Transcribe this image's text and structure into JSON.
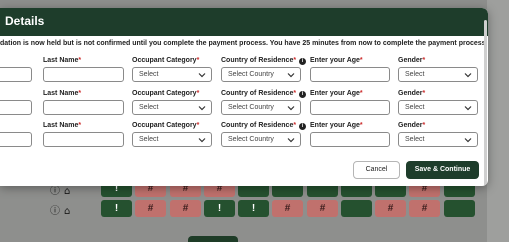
{
  "modal": {
    "title": "Details",
    "notice": "dation is now held but is not confirmed until you complete the payment process. You have 25 minutes from now to complete the payment process.",
    "required_mark": "*",
    "labels": {
      "last_name": "Last Name",
      "occupant_category": "Occupant Category",
      "country": "Country of Residence",
      "age": "Enter your Age",
      "gender": "Gender"
    },
    "rows": [
      {
        "first_name": "",
        "last_name": "",
        "occupant_category": "Select",
        "country": "Select Country",
        "age": "",
        "gender": "Select"
      },
      {
        "first_name": "",
        "last_name": "",
        "occupant_category": "Select",
        "country": "Select Country",
        "age": "",
        "gender": "Select"
      },
      {
        "first_name": "",
        "last_name": "",
        "occupant_category": "Select",
        "country": "Select Country",
        "age": "",
        "gender": "Select"
      }
    ],
    "cancel_label": "Cancel",
    "save_label": "Save & Continue"
  },
  "background": {
    "icons": [
      "info-icon",
      "home-icon"
    ],
    "rows": [
      {
        "cells": [
          "!",
          "#",
          "#",
          "#",
          "",
          "",
          "",
          "",
          "",
          "#",
          ""
        ]
      },
      {
        "cells": [
          "!",
          "#",
          "#",
          "!",
          "!",
          "#",
          "#",
          "",
          "#",
          "#",
          ""
        ]
      }
    ],
    "colors": {
      "green": "#25512f",
      "red": "#c0716d",
      "header": "#1e3d2b"
    }
  }
}
